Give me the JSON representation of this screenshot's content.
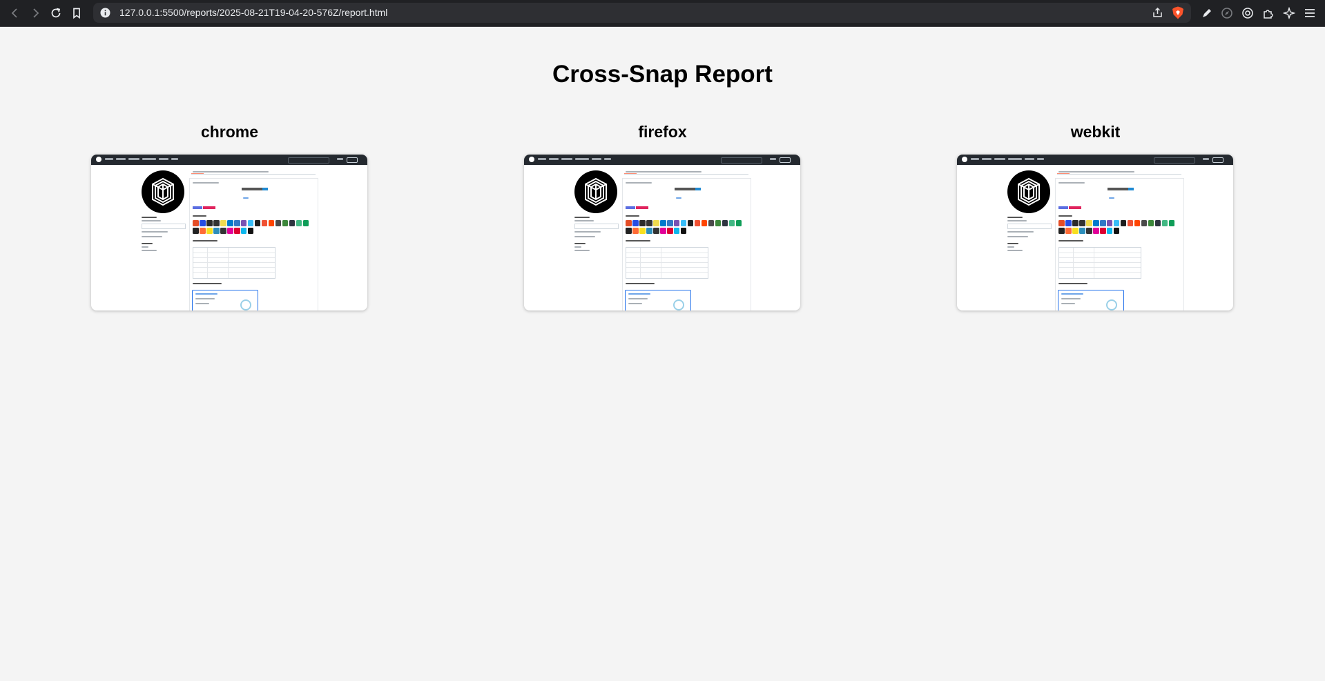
{
  "browser": {
    "url": "127.0.0.1:5500/reports/2025-08-21T19-04-20-576Z/report.html",
    "icons": [
      "back-icon",
      "forward-icon",
      "reload-icon",
      "bookmark-icon",
      "info-icon",
      "share-icon",
      "brave-shields-icon",
      "pen-icon",
      "leo-icon",
      "wallet-icon",
      "extensions-icon",
      "ai-icon",
      "menu-icon"
    ]
  },
  "page": {
    "title": "Cross-Snap Report"
  },
  "cards": [
    {
      "browser": "chrome"
    },
    {
      "browser": "firefox"
    },
    {
      "browser": "webkit"
    }
  ],
  "thumbnail": {
    "profile_name": "Raphaël",
    "stack_heading": "Stack",
    "projects_heading": "Projets en cours",
    "stats_heading": "GitHub Stats"
  },
  "colors": {
    "page_bg": "#f4f4f4",
    "chrome_bg": "#202124",
    "url_bg": "#2e2f33",
    "github_header": "#24292f",
    "accent_blue": "#1f6feb"
  }
}
